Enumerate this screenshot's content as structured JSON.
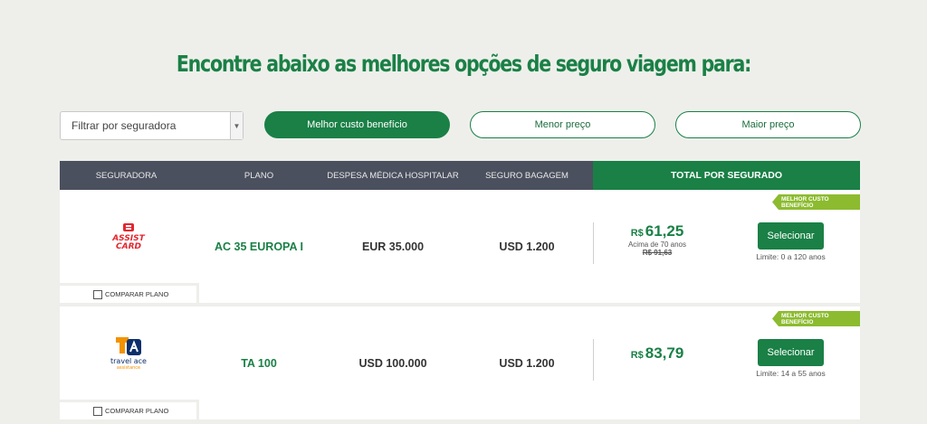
{
  "headline": "Encontre abaixo as melhores opções de seguro viagem para:",
  "filter": {
    "placeholder": "Filtrar por seguradora"
  },
  "sort": {
    "best": "Melhor custo benefício",
    "lowest": "Menor preço",
    "highest": "Maior preço"
  },
  "table": {
    "headers": [
      "SEGURADORA",
      "PLANO",
      "DESPESA MÉDICA HOSPITALAR",
      "SEGURO BAGAGEM"
    ],
    "total_header": "TOTAL POR SEGURADO"
  },
  "rows": [
    {
      "logo_name": "ASSIST CARD",
      "plan": "AC 35 EUROPA I",
      "medical": "EUR 35.000",
      "baggage": "USD 1.200",
      "currency": "R$",
      "price": "61,25",
      "note": "Acima de 70 anos",
      "old_price": "R$ 91,63",
      "badge": "MELHOR CUSTO BENEFÍCIO",
      "select": "Selecionar",
      "limit": "Limite: 0 a 120 anos",
      "compare": "COMPARAR PLANO"
    },
    {
      "logo_name": "travel ace assistance",
      "plan": "TA 100",
      "medical": "USD 100.000",
      "baggage": "USD 1.200",
      "currency": "R$",
      "price": "83,79",
      "badge": "MELHOR CUSTO BENEFÍCIO",
      "select": "Selecionar",
      "limit": "Limite: 14 a 55 anos",
      "compare": "COMPARAR PLANO"
    }
  ],
  "colors": {
    "green": "#1a8046",
    "header_gray": "#4a505e",
    "badge_green": "#8cbb2f",
    "assist_red": "#e3262f"
  }
}
